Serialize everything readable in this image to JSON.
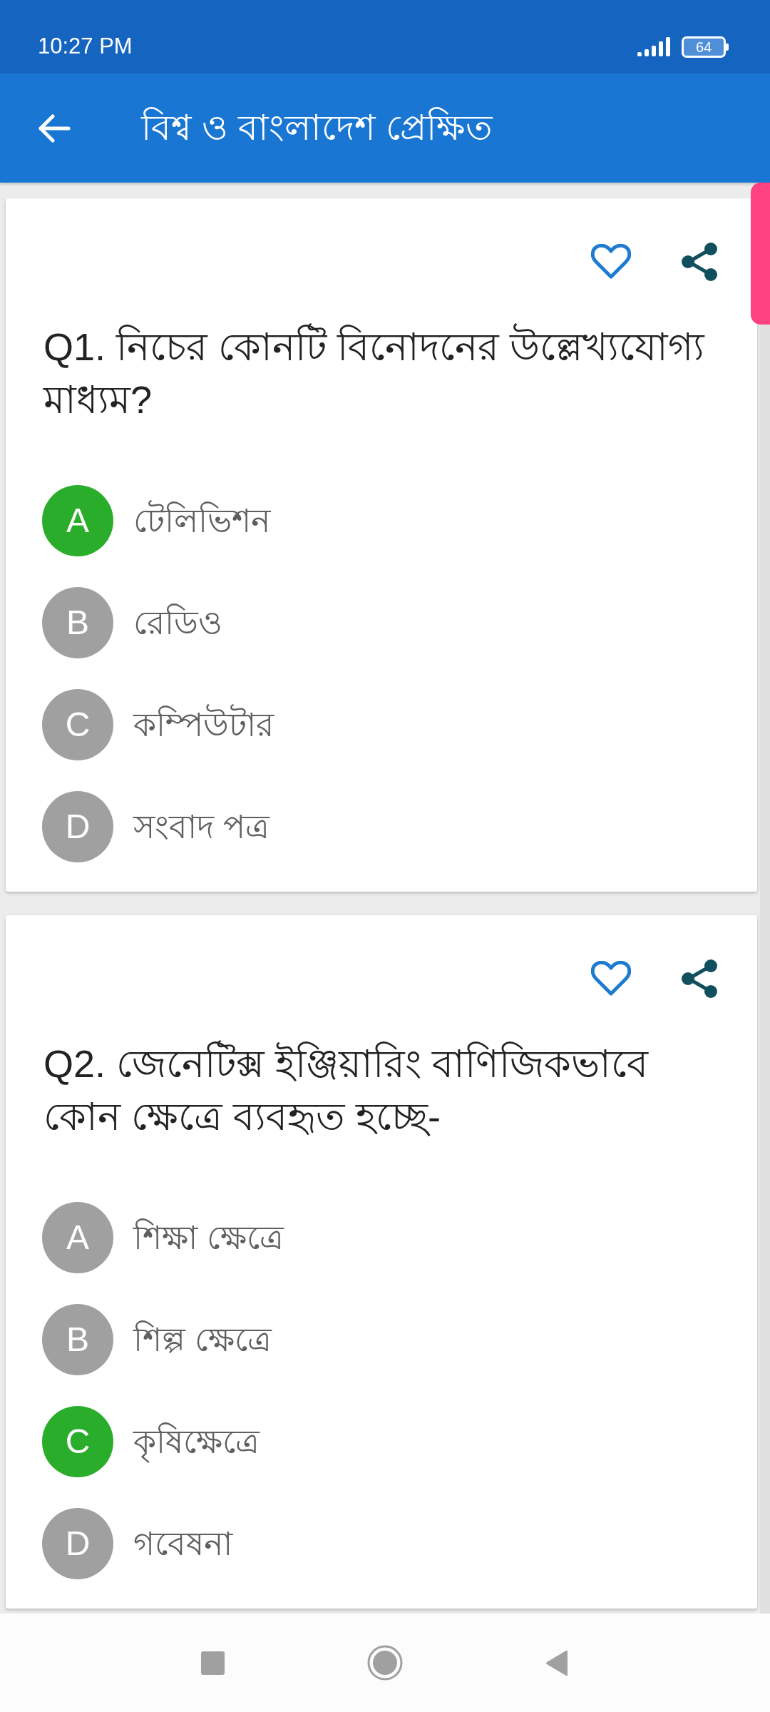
{
  "status_bar": {
    "time": "10:27 PM",
    "battery": "64"
  },
  "app_bar": {
    "title": "বিশ্ব ও বাংলাদেশ প্রেক্ষিত"
  },
  "questions": [
    {
      "text": "Q1. নিচের কোনটি বিনোদনের উল্লেখ্যযোগ্য মাধ্যম?",
      "favorite": false,
      "options": [
        {
          "letter": "A",
          "text": "টেলিভিশন",
          "correct": true
        },
        {
          "letter": "B",
          "text": "রেডিও",
          "correct": false
        },
        {
          "letter": "C",
          "text": "কম্পিউটার",
          "correct": false
        },
        {
          "letter": "D",
          "text": "সংবাদ পত্র",
          "correct": false
        }
      ]
    },
    {
      "text": "Q2. জেনেটিক্স ইঞ্জিয়ারিং বাণিজিকভাবে কোন ক্ষেত্রে ব্যবহৃত হচ্ছে-",
      "favorite": false,
      "options": [
        {
          "letter": "A",
          "text": "শিক্ষা ক্ষেত্রে",
          "correct": false
        },
        {
          "letter": "B",
          "text": "শিল্প ক্ষেত্রে",
          "correct": false
        },
        {
          "letter": "C",
          "text": "কৃষিক্ষেত্রে",
          "correct": true
        },
        {
          "letter": "D",
          "text": "গবেষনা",
          "correct": false
        }
      ]
    }
  ]
}
